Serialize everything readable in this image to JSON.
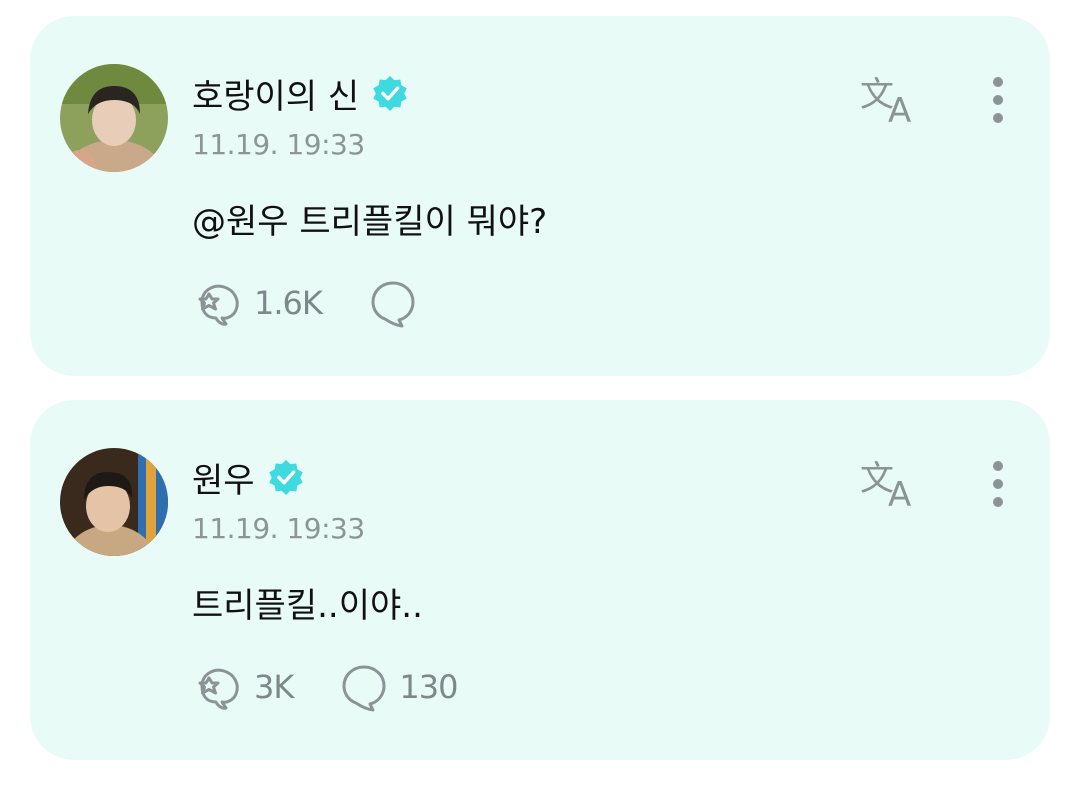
{
  "posts": [
    {
      "author": "호랑이의 신",
      "verified": true,
      "timestamp": "11.19. 19:33",
      "text": "@원우 트리플킬이 뭐야?",
      "reactions": "1.6K",
      "comments": ""
    },
    {
      "author": "원우",
      "verified": true,
      "timestamp": "11.19. 19:33",
      "text": "트리플킬..이야..",
      "reactions": "3K",
      "comments": "130"
    }
  ],
  "icons": {
    "verified": "verified-badge-icon",
    "translate": "translate-icon",
    "more": "more-vertical-icon",
    "reaction": "reaction-icon",
    "comment": "comment-icon"
  },
  "colors": {
    "card_background": "#e9fbf6",
    "verified_badge": "#3fd9e0",
    "muted_text": "#8c9698",
    "icon": "#8a9496"
  }
}
